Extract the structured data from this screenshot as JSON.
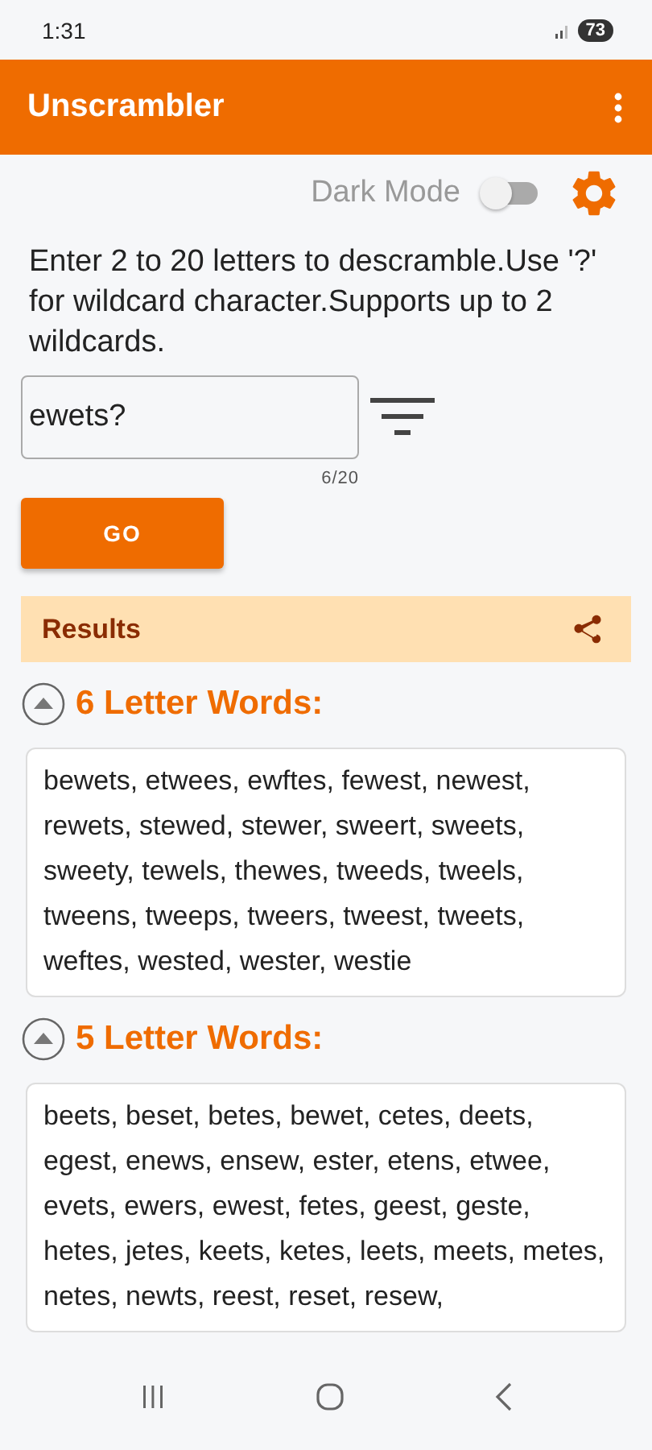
{
  "status_bar": {
    "time": "1:31",
    "battery": "73"
  },
  "app_bar": {
    "title": "Unscrambler"
  },
  "dark_mode": {
    "label": "Dark Mode",
    "on": false
  },
  "instructions": "Enter 2 to 20 letters to descramble.Use '?' for wildcard character.Supports up to 2 wildcards.",
  "input": {
    "value": "ewets?",
    "counter": "6/20"
  },
  "go_button": "GO",
  "results": {
    "title": "Results"
  },
  "sections": [
    {
      "title": "6 Letter Words:",
      "expanded": true,
      "words": "bewets, etwees, ewftes, fewest, newest, rewets, stewed, stewer, sweert, sweets, sweety, tewels, thewes, tweeds, tweels, tweens, tweeps, tweers, tweest, tweets, weftes, wested, wester, westie"
    },
    {
      "title": "5 Letter Words:",
      "expanded": true,
      "words": "beets, beset, betes, bewet, cetes, deets, egest, enews, ensew, ester, etens, etwee, evets, ewers, ewest, fetes, geest, geste, hetes, jetes, keets, ketes, leets, meets, metes, netes, newts, reest, reset, resew,"
    }
  ]
}
